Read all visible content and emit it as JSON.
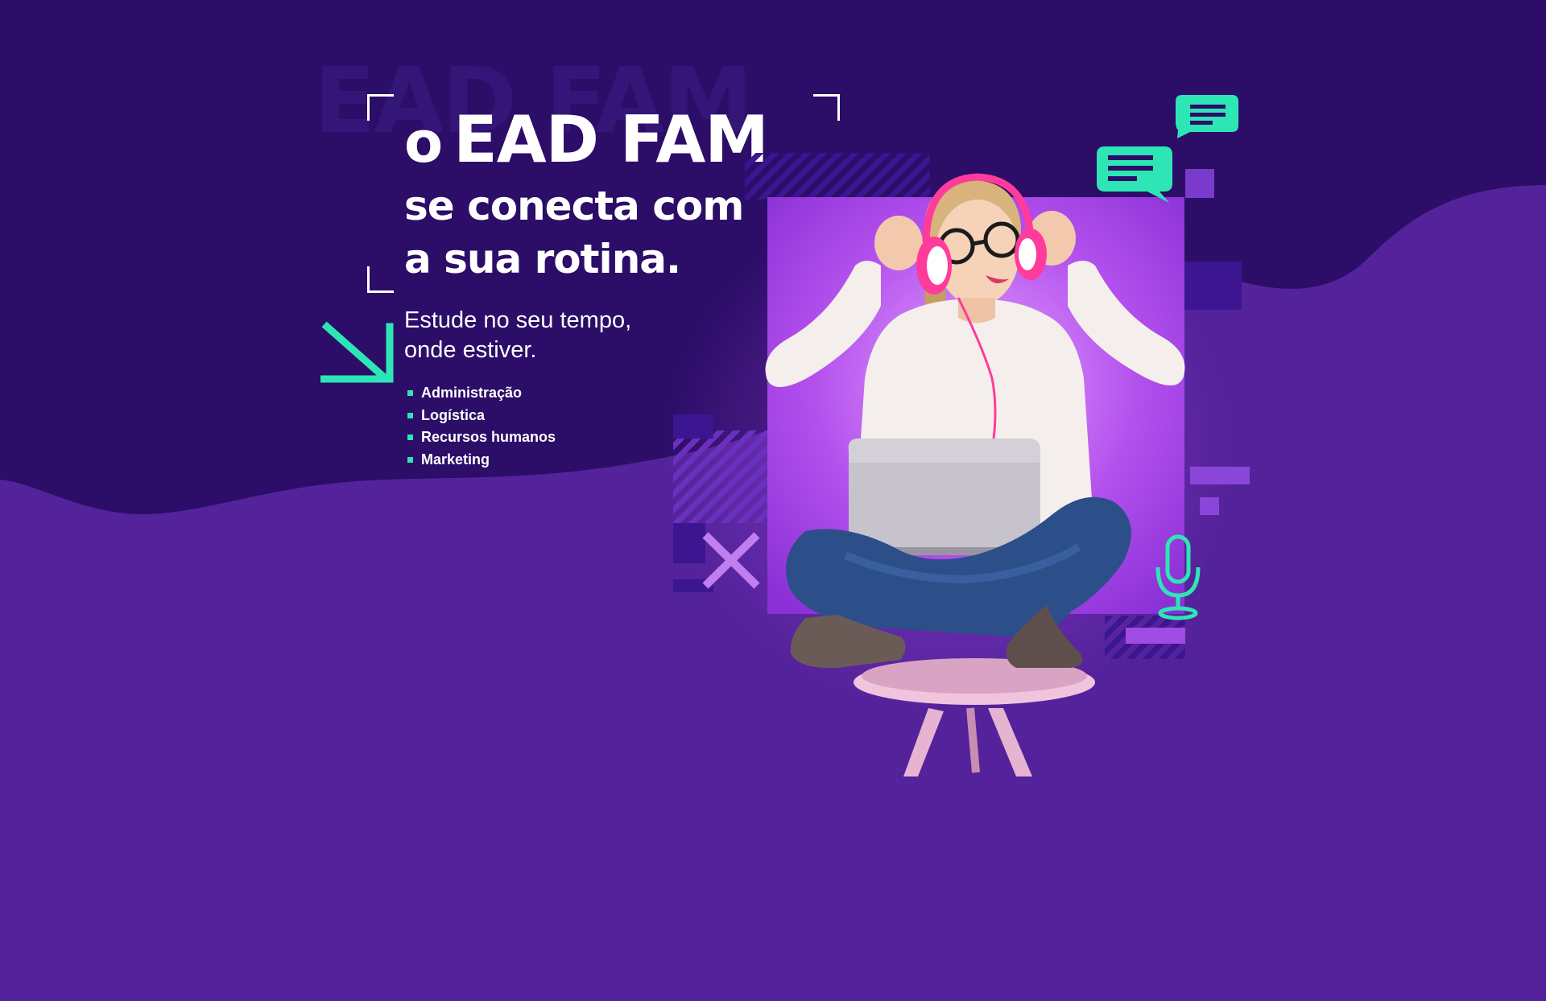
{
  "hero": {
    "ghost_text": "EAD FAM",
    "headline": {
      "prefix": "o",
      "brand": "EAD FAM",
      "line2": "se conecta com",
      "line3": "a sua rotina."
    },
    "subtitle": {
      "line1": "Estude no seu tempo,",
      "line2": "onde estiver."
    },
    "courses": [
      "Administração",
      "Logística",
      "Recursos humanos",
      "Marketing"
    ]
  },
  "colors": {
    "top_band": "#2c0d68",
    "background": "#54229a",
    "accent_mint": "#2ee6b5",
    "photo_panel": "#b451ee",
    "text": "#ffffff"
  },
  "icons": {
    "arrow": "arrow-down-right-icon",
    "chat_large": "chat-bubble-icon",
    "chat_small": "chat-bubble-icon",
    "microphone": "microphone-icon",
    "cross": "cross-icon"
  }
}
